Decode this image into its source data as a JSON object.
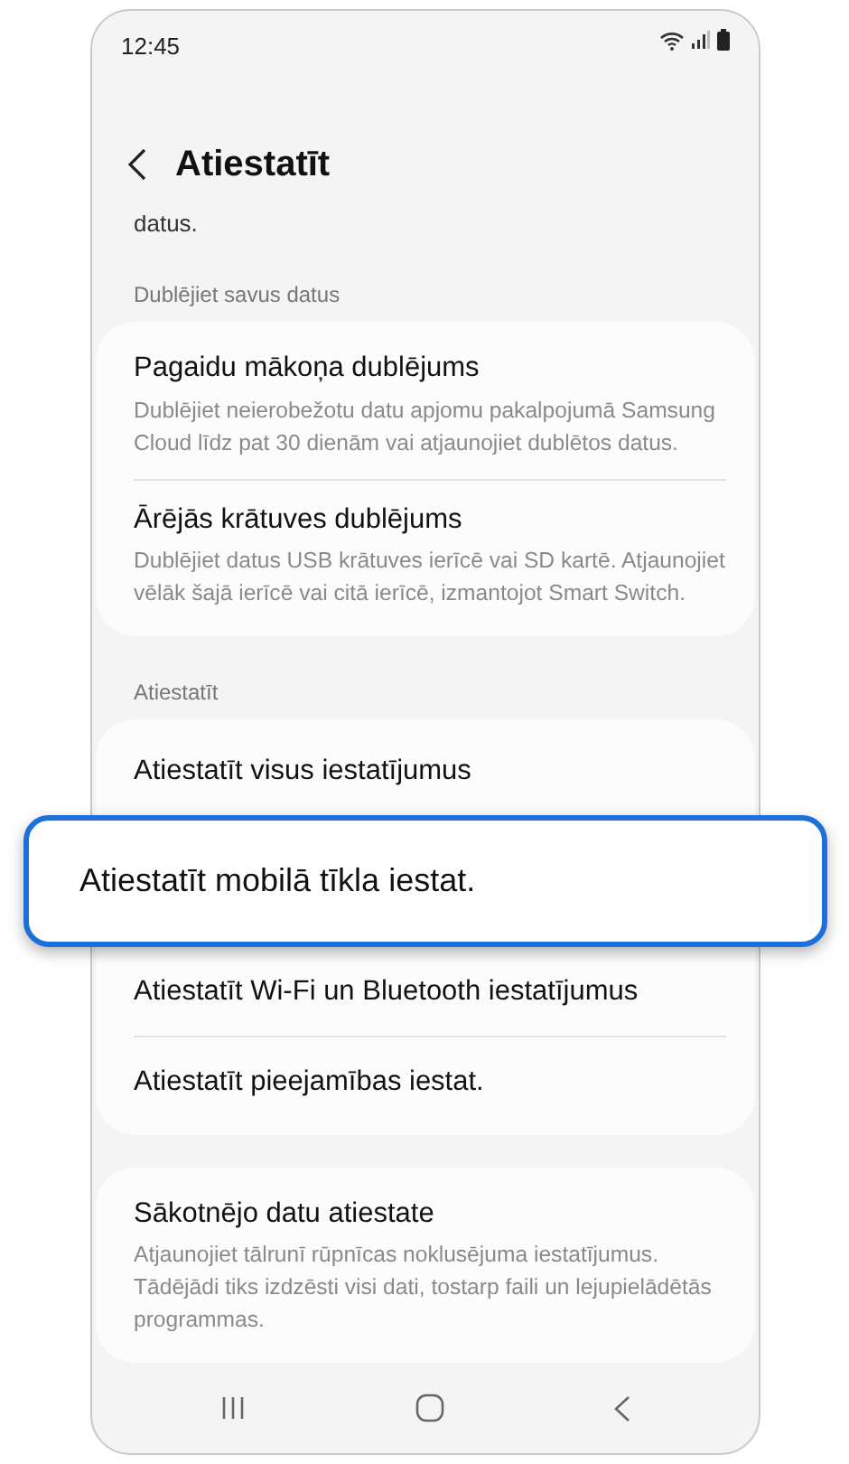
{
  "status_bar": {
    "time": "12:45"
  },
  "header": {
    "title": "Atiestatīt"
  },
  "top_fragment": "datus.",
  "sections": [
    {
      "label": "Dublējiet savus datus",
      "items": [
        {
          "title": "Pagaidu mākoņa dublējums",
          "description": "Dublējiet neierobežotu datu apjomu pakalpojumā Samsung Cloud līdz pat 30 dienām vai atjaunojiet dublētos datus.",
          "highlighted": false
        },
        {
          "title": "Ārējās krātuves dublējums",
          "description": "Dublējiet datus USB krātuves ierīcē vai SD kartē. Atjaunojiet vēlāk šajā ierīcē vai citā ierīcē, izmantojot Smart Switch.",
          "highlighted": false
        }
      ]
    },
    {
      "label": "Atiestatīt",
      "items": [
        {
          "title": "Atiestatīt visus iestatījumus",
          "highlighted": false
        },
        {
          "title": "Atiestatīt mobilā tīkla iestat.",
          "highlighted": true
        },
        {
          "title": "Atiestatīt Wi-Fi un Bluetooth iestatījumus",
          "highlighted": false
        },
        {
          "title": "Atiestatīt pieejamības iestat.",
          "highlighted": false
        }
      ]
    },
    {
      "items": [
        {
          "title": "Sākotnējo datu atiestate",
          "description": "Atjaunojiet tālrunī rūpnīcas noklusējuma iestatījumus. Tādējādi tiks izdzēsti visi dati, tostarp faili un lejupielādētās programmas.",
          "highlighted": false
        }
      ]
    }
  ]
}
